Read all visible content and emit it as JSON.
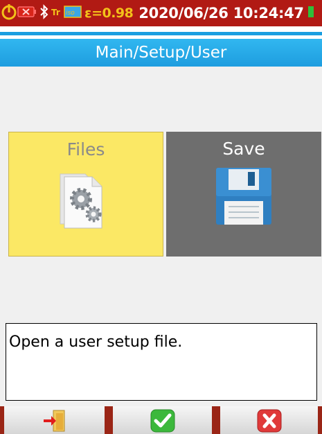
{
  "status_bar": {
    "emissivity": "ε=0.98",
    "datetime": "2020/06/26 10:24:47",
    "icons": [
      "power-warning-icon",
      "battery-empty-icon",
      "bluetooth-icon",
      "tr-icon",
      "iso-icon",
      "battery-icon"
    ]
  },
  "header": {
    "title": "Main/Setup/User"
  },
  "tiles": [
    {
      "label": "Files",
      "icon": "file-settings-icon",
      "selected": true
    },
    {
      "label": "Save",
      "icon": "floppy-disk-icon",
      "selected": false
    }
  ],
  "description": "Open a user setup file.",
  "bottom_bar": {
    "buttons": [
      {
        "name": "exit-button",
        "icon": "exit-door-icon"
      },
      {
        "name": "confirm-button",
        "icon": "checkmark-icon"
      },
      {
        "name": "cancel-button",
        "icon": "close-icon"
      }
    ]
  },
  "colors": {
    "status_bar_bg": "#b11a14",
    "header_accent": "#1e9ddf",
    "selected_tile": "#fbe865",
    "unselected_tile": "#6e6e6e",
    "confirm_green": "#3cb83c",
    "cancel_red": "#e03a3a"
  }
}
